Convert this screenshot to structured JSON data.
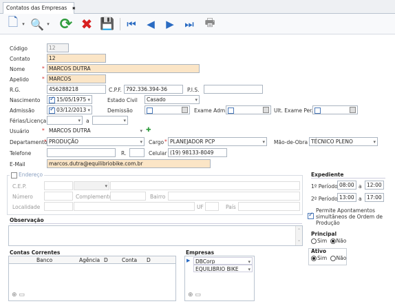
{
  "tab": {
    "title": "Contatos das Empresas",
    "close": "✖"
  },
  "toolbar": {
    "new": "🗋",
    "search": "🔍",
    "refresh": "⟳",
    "delete": "✖",
    "save": "💾",
    "first": "⏮",
    "prev": "◀",
    "next": "▶",
    "last": "⏭",
    "print": "🖶"
  },
  "form": {
    "codigo_label": "Código",
    "codigo": "12",
    "contato_label": "Contato",
    "contato": "12",
    "nome_label": "Nome",
    "nome": "MARCOS DUTRA",
    "apelido_label": "Apelido",
    "apelido": "MARCOS",
    "rg_label": "R.G.",
    "rg": "456288218",
    "cpf_label": "C.P.F.",
    "cpf": "792.336.394-36",
    "pis_label": "P.I.S.",
    "pis": "",
    "nasc_label": "Nascimento",
    "nasc": "15/05/1975",
    "estado_label": "Estado Civil",
    "estado": "Casado",
    "admissao_label": "Admissão",
    "admissao": "03/12/2013",
    "demissao_label": "Demissão",
    "exame_adm_label": "Exame Adm.",
    "ult_exame_label": "Ult. Exame Per.",
    "ferias_label": "Férias/Licença",
    "ferias_a": "a",
    "usuario_label": "Usuário",
    "usuario": "MARCOS DUTRA",
    "usuario_add": "✚",
    "depto_label": "Departamento",
    "depto": "PRODUÇÃO",
    "cargo_label": "Cargo",
    "cargo": "PLANEJADOR PCP",
    "mao_label": "Mão-de-Obra",
    "mao": "TÉCNICO PLENO",
    "telefone_label": "Telefone",
    "telefone": "",
    "ramal_label": "R.",
    "ramal": "",
    "celular_label": "Celular",
    "celular": "(19) 98133-8049",
    "email_label": "E-Mail",
    "email": "marcos.dutra@equilibriobike.com.br"
  },
  "endereco": {
    "title": "Endereço",
    "cep_label": "C.E.P.",
    "numero_label": "Número",
    "complemento_label": "Complemento",
    "bairro_label": "Bairro",
    "localidade_label": "Localidade",
    "uf_label": "UF",
    "pais_label": "País"
  },
  "expediente": {
    "title": "Expediente",
    "p1_label": "1º Período",
    "p1_start": "08:00",
    "p1_sep": "a",
    "p1_end": "12:00",
    "p2_label": "2º Período",
    "p2_start": "13:00",
    "p2_sep": "a",
    "p2_end": "17:00"
  },
  "permite": "Permite Apontamentos simultâneos de Ordem de Produção",
  "principal": {
    "title": "Principal",
    "sim": "Sim",
    "nao": "Não"
  },
  "ativo": {
    "title": "Ativo",
    "sim": "Sim",
    "nao": "Não"
  },
  "observacao": {
    "title": "Observação"
  },
  "contas": {
    "title": "Contas Correntes",
    "cols": [
      "Banco",
      "Agência",
      "D",
      "Conta",
      "D"
    ]
  },
  "empresas": {
    "title": "Empresas",
    "items": [
      "DBCorp",
      "EQUILIBRIO BIKE"
    ]
  },
  "colors": {
    "accent": "#1b4f9c",
    "required": "#fbe5c6",
    "delete": "#d82020",
    "refresh": "#2e9c3c"
  }
}
